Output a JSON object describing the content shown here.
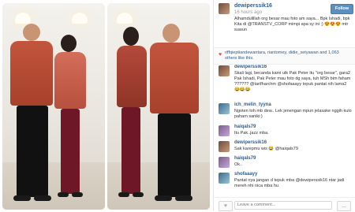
{
  "post": {
    "username": "dewiperssik16",
    "time": "16 hours ago",
    "caption": "Alhamdulillah org besar mau foto am saya... Bpk Ishadi, bpk Kita di @TRANSTV_CORP mimpi apa sy ini ;) 😍😍😍 mtr suwun",
    "follow_label": "Follow"
  },
  "likes": {
    "text": "riffqieptiandewantara, riantomey, didie_setyawan and 1,063 others like this."
  },
  "comments": [
    {
      "username": "dewiperssik16",
      "text": "Skali lagi, becanda kami utk Pak Peter itu \"org besar\", gara2 Pak Ishadi, Pak Peter mau foto dg saya, tuh MSh bim faham ?????? @tarifharchm @shofaaayy tepuk pantat nih lama2 😂😂😂"
    },
    {
      "username": "ich_melin_tyyna",
      "text": "Ngoten toh mb dew.. Lek jenengan mpun jelasake nggih kulo paham saniki:)"
    },
    {
      "username": "haiqals79",
      "text": "Itu Pak..jazz mba."
    },
    {
      "username": "dewiperssik16",
      "text": "Sak karepmu wis 😂 @haiqals79"
    },
    {
      "username": "haiqals79",
      "text": "Ok.."
    },
    {
      "username": "shofaaayy",
      "text": "Pantat nya jangan d tepuk mba @dewiperssik16 ntar jadi mereh nhi nica mba hu"
    }
  ],
  "footer": {
    "comment_placeholder": "Leave a comment...",
    "more_label": "..."
  }
}
